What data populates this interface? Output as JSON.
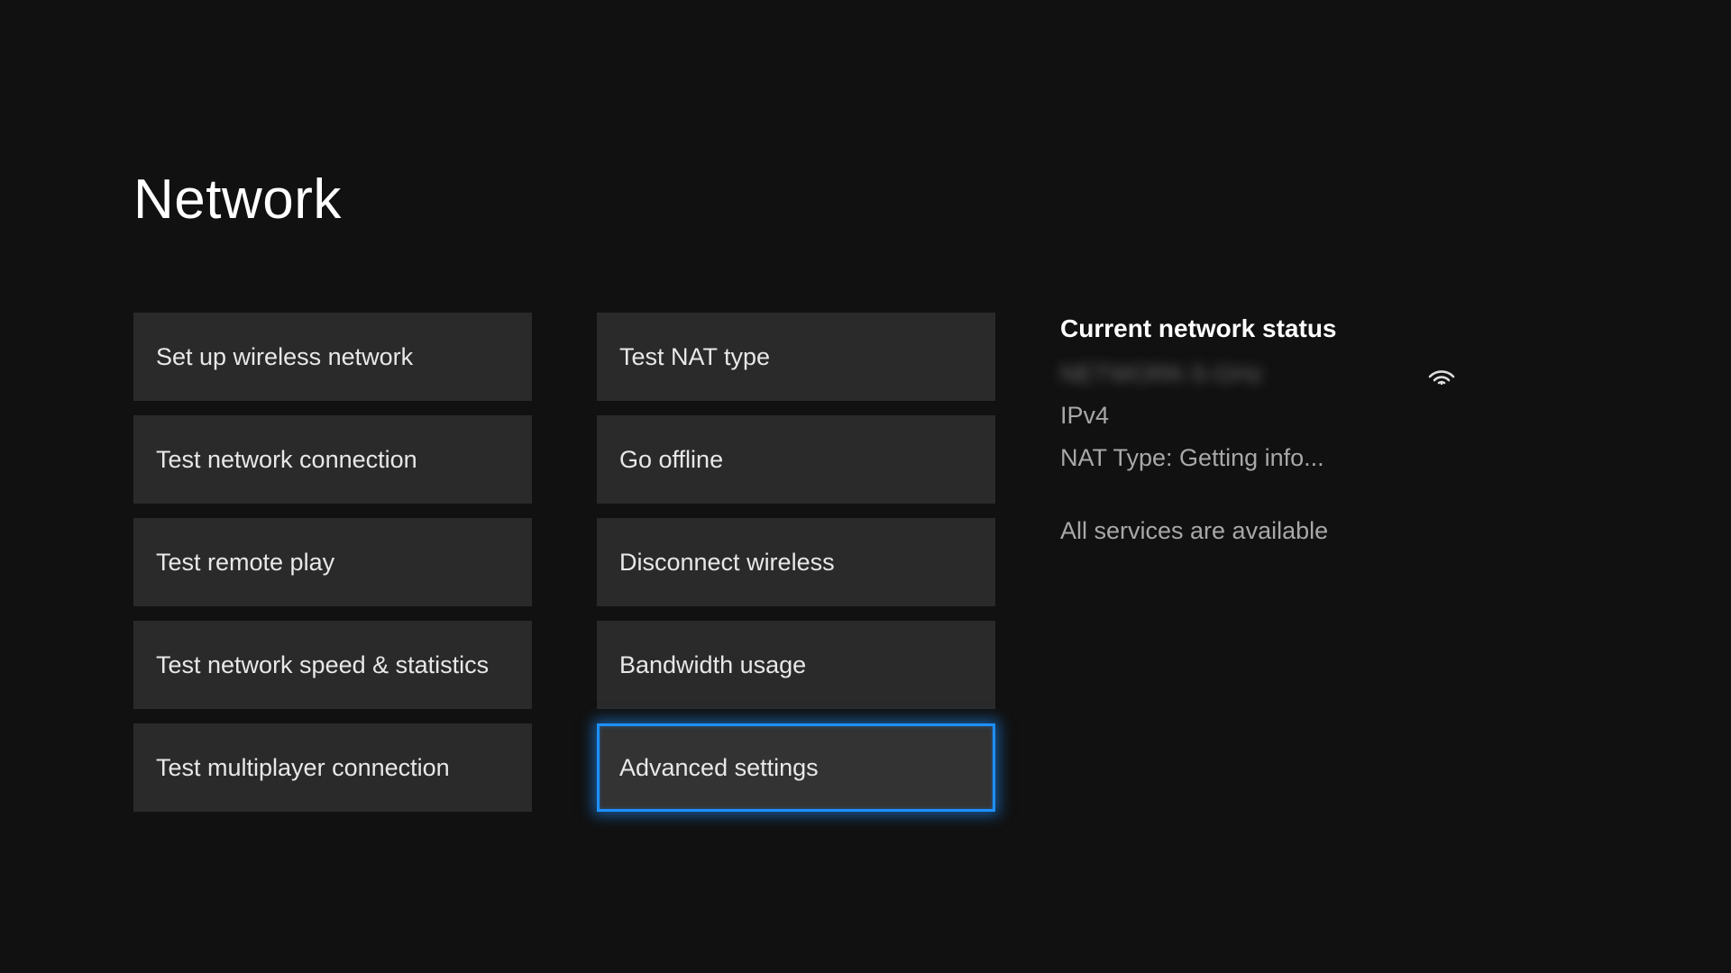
{
  "title": "Network",
  "columns": {
    "left": [
      "Set up wireless network",
      "Test network connection",
      "Test remote play",
      "Test network speed & statistics",
      "Test multiplayer connection"
    ],
    "right": [
      "Test NAT type",
      "Go offline",
      "Disconnect wireless",
      "Bandwidth usage",
      "Advanced settings"
    ]
  },
  "selected": "Advanced settings",
  "status": {
    "heading": "Current network status",
    "network_name_obscured": "NETWORK-5-GHz",
    "ip_version": "IPv4",
    "nat_line": "NAT Type: Getting info...",
    "services_line": "All services are available"
  }
}
